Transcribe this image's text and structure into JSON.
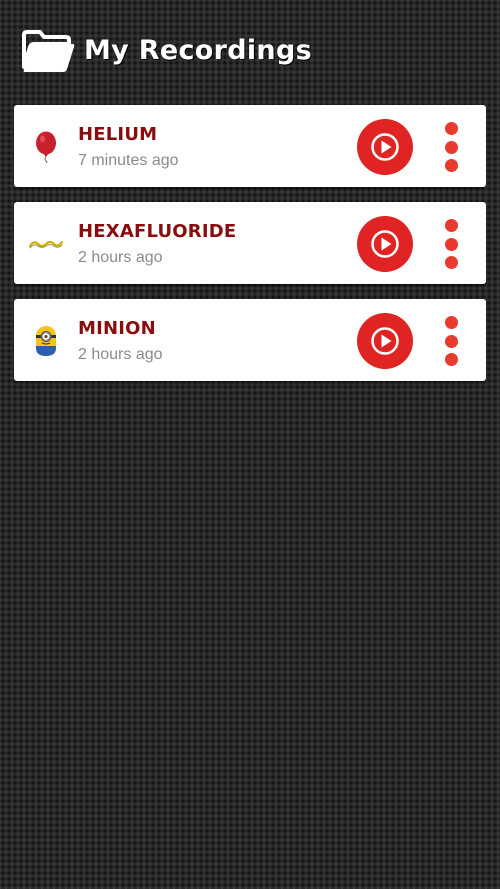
{
  "header": {
    "icon": "folder-open-icon",
    "title": "My Recordings"
  },
  "colors": {
    "accent": "#e02424",
    "title_text": "#8a0c0c",
    "subtitle_text": "#8a8a8a",
    "card_background": "#ffffff"
  },
  "recordings": [
    {
      "title": "HELIUM",
      "time": "7 minutes ago",
      "icon": "balloon-icon",
      "play_icon": "play-icon",
      "menu_icon": "more-vertical-icon"
    },
    {
      "title": "HEXAFLUORIDE",
      "time": "2 hours ago",
      "icon": "wave-icon",
      "play_icon": "play-icon",
      "menu_icon": "more-vertical-icon"
    },
    {
      "title": "MINION",
      "time": "2 hours ago",
      "icon": "minion-icon",
      "play_icon": "play-icon",
      "menu_icon": "more-vertical-icon"
    }
  ]
}
